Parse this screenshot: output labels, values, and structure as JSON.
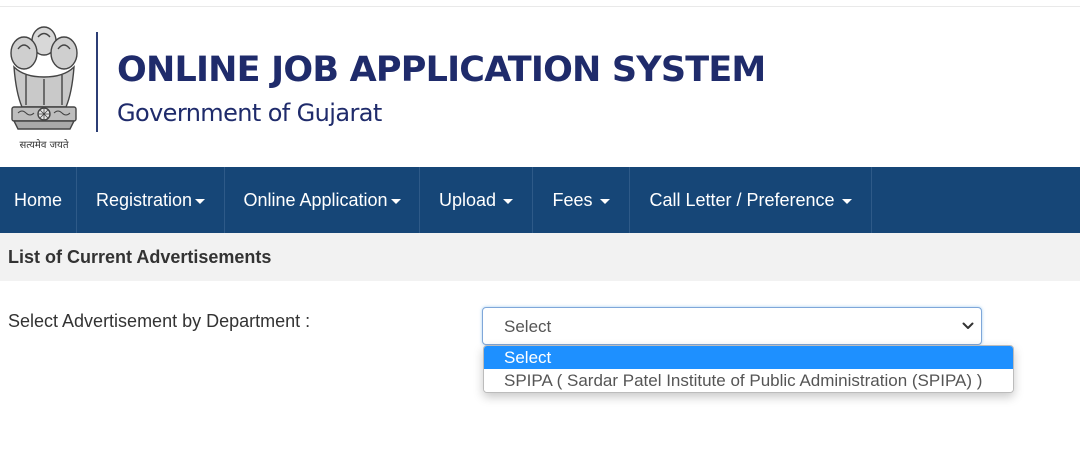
{
  "header": {
    "title": "ONLINE JOB APPLICATION SYSTEM",
    "subtitle": "Government of Gujarat",
    "motto": "सत्यमेव जयते",
    "emblem_icon": "national-emblem-icon"
  },
  "nav": {
    "items": [
      {
        "label": "Home",
        "has_dropdown": false
      },
      {
        "label": "Registration",
        "has_dropdown": true
      },
      {
        "label": "Online Application",
        "has_dropdown": true
      },
      {
        "label": "Upload",
        "has_dropdown": true
      },
      {
        "label": "Fees",
        "has_dropdown": true
      },
      {
        "label": "Call Letter / Preference",
        "has_dropdown": true
      }
    ]
  },
  "section": {
    "title": "List of Current Advertisements"
  },
  "filter": {
    "label": "Select Advertisement by Department :",
    "selected": "Select",
    "options": [
      "Select",
      "SPIPA ( Sardar Patel Institute of Public Administration (SPIPA) )"
    ]
  },
  "colors": {
    "nav_background": "#164677",
    "title_color": "#1f2b6b",
    "option_highlight": "#1e90ff",
    "section_bar": "#f2f2f2"
  }
}
